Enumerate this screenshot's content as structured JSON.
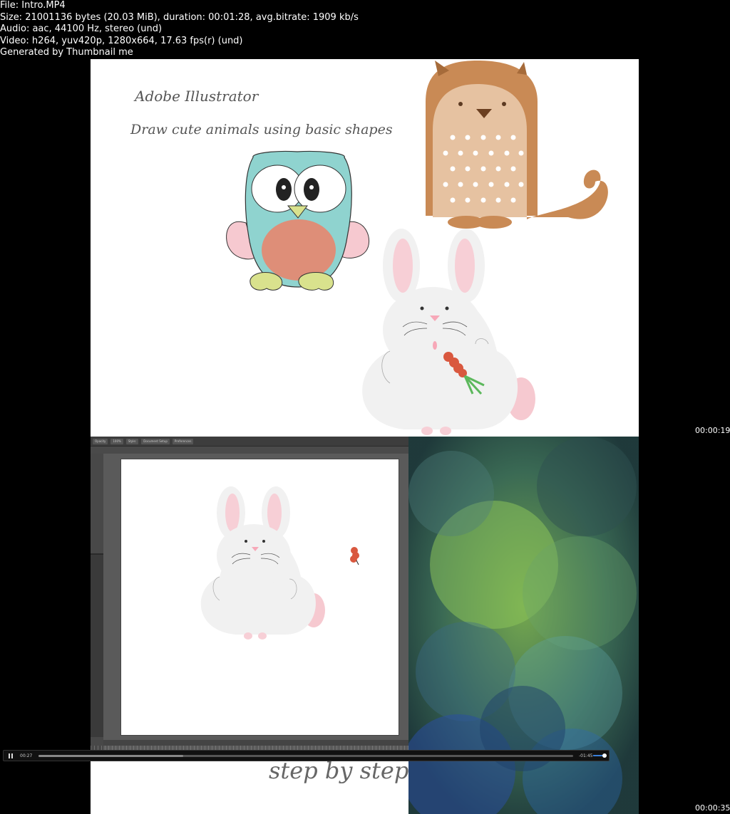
{
  "header": {
    "file": "File: Intro.MP4",
    "size": "Size: 21001136 bytes (20.03 MiB), duration: 00:01:28, avg.bitrate: 1909 kb/s",
    "audio": "Audio: aac, 44100 Hz, stereo (und)",
    "video": "Video: h264, yuv420p, 1280x664, 17.63 fps(r) (und)",
    "generator": "Generated by Thumbnail me"
  },
  "frame1": {
    "title": "Adobe Illustrator",
    "subtitle": "Draw cute animals using basic shapes",
    "timestamp": "00:00:19"
  },
  "frame2": {
    "tagline": "step by step",
    "timestamp": "00:00:35",
    "toolbar": [
      "Opacity",
      "100%",
      "Style:",
      "Document Setup",
      "Preferences"
    ]
  },
  "player": {
    "current_time": "00:27",
    "remaining_time": "-01:45",
    "progress": 0.27,
    "volume": 1.0
  },
  "colors": {
    "owl_body": "#8fd3cf",
    "owl_belly": "#de8e78",
    "owl_wing": "#f6c9d0",
    "owl_feet": "#d9e28d",
    "squirrel": "#c98a55",
    "squirrel_belly": "#e6c2a1",
    "bunny": "#f1f1f1",
    "bunny_ear": "#f7cfd6",
    "carrot": "#d9583f"
  }
}
